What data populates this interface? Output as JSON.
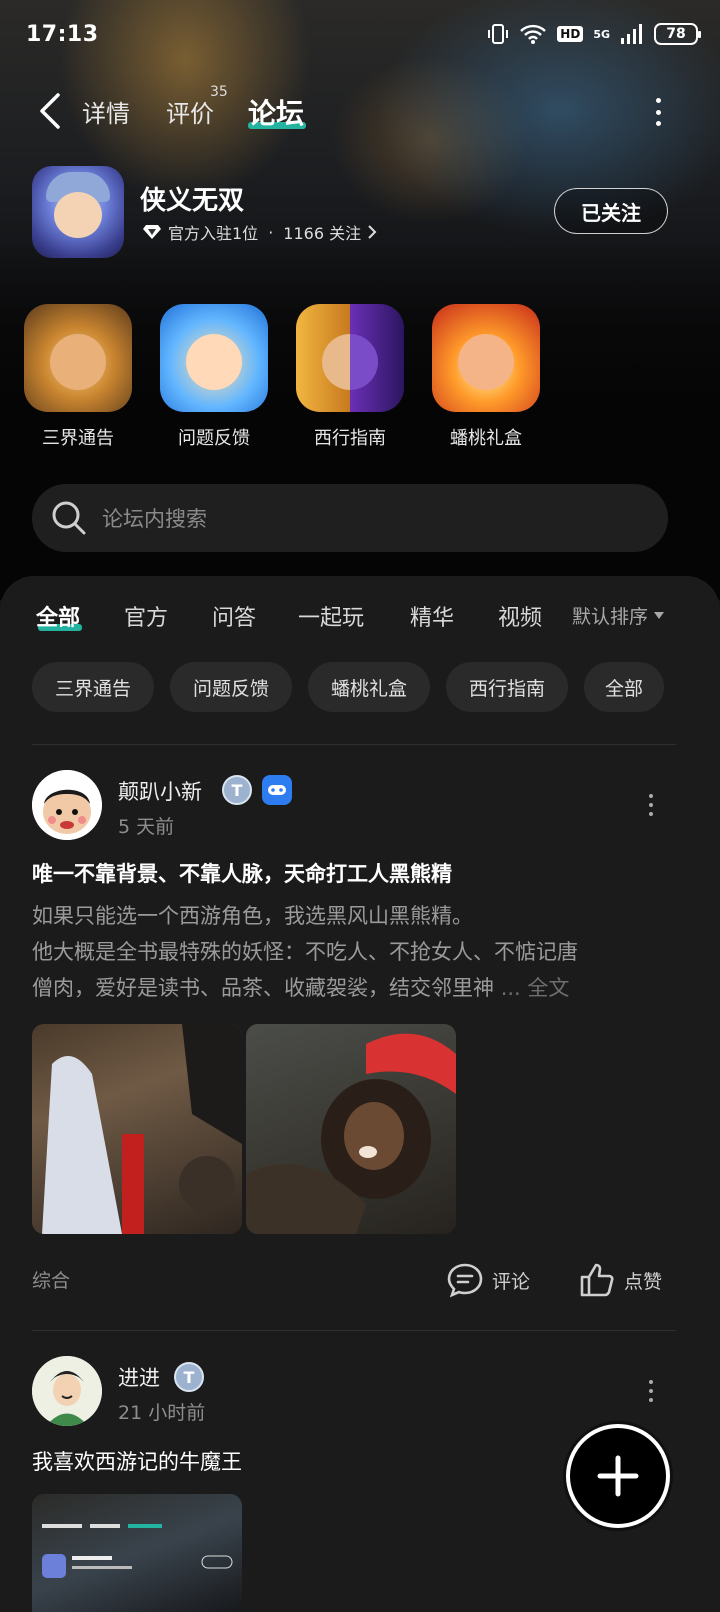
{
  "status_bar": {
    "time": "17:13",
    "network": "5G",
    "hd": "HD",
    "battery": "78"
  },
  "nav": {
    "tabs": [
      {
        "label": "详情"
      },
      {
        "label": "评价",
        "badge": "35"
      },
      {
        "label": "论坛"
      }
    ],
    "active_index": 2
  },
  "game": {
    "name": "侠义无双",
    "meta_official": "官方入驻1位",
    "meta_sep": "·",
    "meta_follow": "1166 关注",
    "follow_label": "已关注"
  },
  "shortcuts": [
    {
      "label": "三界通告"
    },
    {
      "label": "问题反馈"
    },
    {
      "label": "西行指南"
    },
    {
      "label": "蟠桃礼盒"
    }
  ],
  "search": {
    "placeholder": "论坛内搜索"
  },
  "categories": {
    "tabs": [
      "全部",
      "官方",
      "问答",
      "一起玩",
      "精华",
      "视频"
    ],
    "active_index": 0,
    "sort_label": "默认排序"
  },
  "chips": [
    "三界通告",
    "问题反馈",
    "蟠桃礼盒",
    "西行指南",
    "全部"
  ],
  "posts": [
    {
      "author": "颠趴小新",
      "time": "5 天前",
      "title": "唯一不靠背景、不靠人脉，天命打工人黑熊精",
      "body_line1": "如果只能选一个西游角色，我选黑风山黑熊精。",
      "body_line2": "他大概是全书最特殊的妖怪：不吃人、不抢女人、不惦记唐",
      "body_line3": "僧肉，爱好是读书、品茶、收藏袈裟，结交邻里神",
      "more_label": "... 全文",
      "tag": "综合",
      "comment_label": "评论",
      "like_label": "点赞"
    },
    {
      "author": "进进",
      "time": "21 小时前",
      "title": "我喜欢西游记的牛魔王"
    }
  ]
}
